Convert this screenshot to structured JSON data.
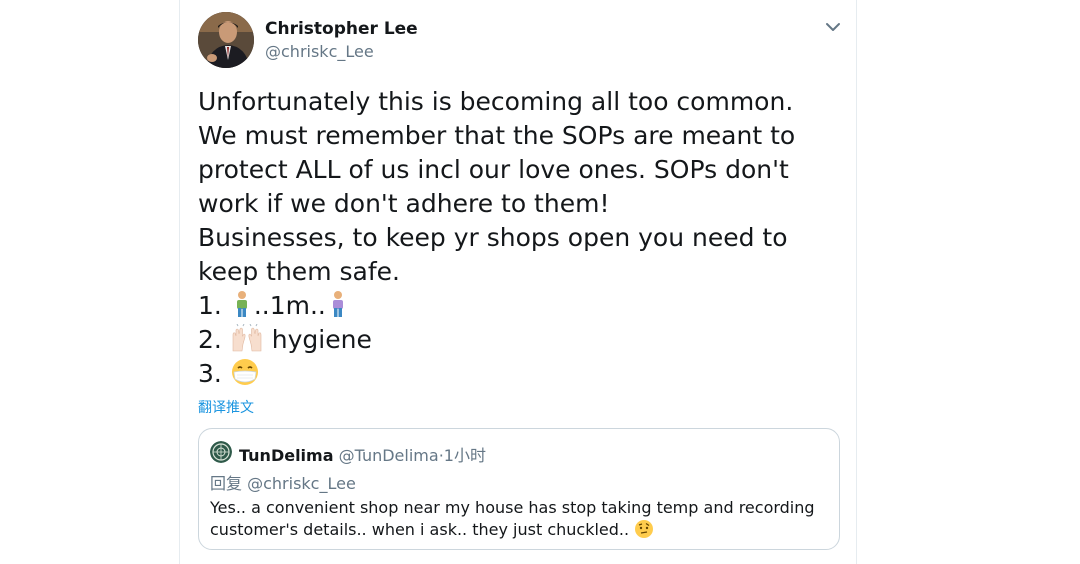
{
  "tweet": {
    "author_name": "Christopher Lee",
    "author_handle": "@chriskc_Lee",
    "lines": [
      "Unfortunately this is becoming all too common.",
      "We must remember that the SOPs are meant to",
      "protect ALL of us incl our love ones. SOPs don't",
      "work if we don't adhere to them!",
      "Businesses, to keep yr shops open you need to",
      "keep them safe."
    ],
    "list": {
      "item1_prefix": "1.",
      "item1_middle": "..1m..",
      "item2_prefix": "2.",
      "item2_text": "hygiene",
      "item3_prefix": "3."
    },
    "icons": {
      "more": "chevron-down-icon",
      "person1": "person-standing-icon",
      "person2": "person-standing-icon",
      "hands": "raising-hands-icon",
      "mask": "face-with-medical-mask-icon",
      "quote_emoji": "face-with-raised-eyebrow-icon"
    },
    "translate_label": "翻译推文"
  },
  "quoted": {
    "name": "TunDelima",
    "handle": "@TunDelima",
    "separator": "·",
    "time": "1小时",
    "reply_prefix": "回复",
    "reply_handle": "@chriskc_Lee",
    "lines": [
      "Yes.. a convenient shop near my house has stop taking temp and recording",
      "customer's details.. when i ask.. they just chuckled.."
    ]
  },
  "colors": {
    "link": "#1b95e0",
    "secondary_text": "#657786",
    "border": "#ccd6dd"
  }
}
